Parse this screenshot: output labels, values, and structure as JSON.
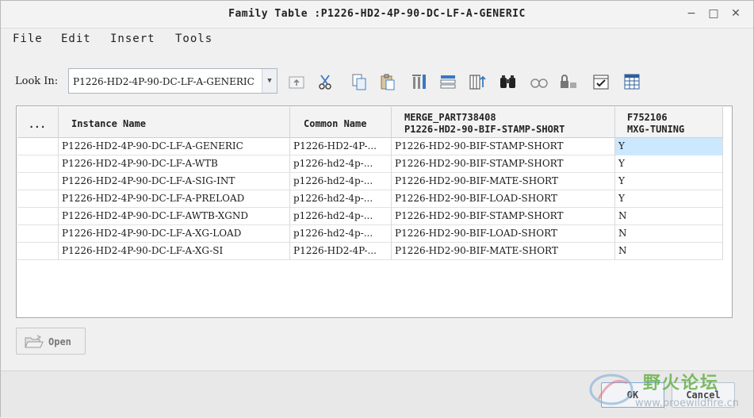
{
  "window": {
    "title": "Family Table :P1226-HD2-4P-90-DC-LF-A-GENERIC",
    "controls": {
      "minimize": "−",
      "maximize": "□",
      "close": "✕"
    }
  },
  "menu": [
    "File",
    "Edit",
    "Insert",
    "Tools"
  ],
  "toolbar": {
    "look_in_label": "Look In:",
    "look_in_value": "P1226-HD2-4P-90-DC-LF-A-GENERIC",
    "icons": [
      "up-level-icon",
      "cut-icon",
      "copy-icon",
      "paste-icon",
      "insert-column-icon",
      "insert-row-icon",
      "table-column-icon",
      "find-icon",
      "preview-icon",
      "lock-icon",
      "verify-icon",
      "table-icon"
    ]
  },
  "table": {
    "headers": {
      "dots": "...",
      "instance": "Instance Name",
      "common": "Common Name",
      "merge_line1": "MERGE_PART738408",
      "merge_line2": "P1226-HD2-90-BIF-STAMP-SHORT",
      "f_line1": "F752106",
      "f_line2": "MXG-TUNING"
    },
    "rows": [
      {
        "instance": "P1226-HD2-4P-90-DC-LF-A-GENERIC",
        "common": "P1226-HD2-4P-...",
        "merge": "P1226-HD2-90-BIF-STAMP-SHORT",
        "f": "Y"
      },
      {
        "instance": "P1226-HD2-4P-90-DC-LF-A-WTB",
        "common": "p1226-hd2-4p-...",
        "merge": "P1226-HD2-90-BIF-STAMP-SHORT",
        "f": "Y"
      },
      {
        "instance": "P1226-HD2-4P-90-DC-LF-A-SIG-INT",
        "common": "p1226-hd2-4p-...",
        "merge": "P1226-HD2-90-BIF-MATE-SHORT",
        "f": "Y"
      },
      {
        "instance": "P1226-HD2-4P-90-DC-LF-A-PRELOAD",
        "common": "p1226-hd2-4p-...",
        "merge": "P1226-HD2-90-BIF-LOAD-SHORT",
        "f": "Y"
      },
      {
        "instance": "P1226-HD2-4P-90-DC-LF-AWTB-XGND",
        "common": "p1226-hd2-4p-...",
        "merge": "P1226-HD2-90-BIF-STAMP-SHORT",
        "f": "N"
      },
      {
        "instance": "P1226-HD2-4P-90-DC-LF-A-XG-LOAD",
        "common": "p1226-hd2-4p-...",
        "merge": "P1226-HD2-90-BIF-LOAD-SHORT",
        "f": "N"
      },
      {
        "instance": "P1226-HD2-4P-90-DC-LF-A-XG-SI",
        "common": "P1226-HD2-4P-...",
        "merge": "P1226-HD2-90-BIF-MATE-SHORT",
        "f": "N"
      }
    ]
  },
  "buttons": {
    "open": "Open",
    "ok": "OK",
    "cancel": "Cancel"
  },
  "watermark": {
    "text": "野火论坛",
    "url": "www.proewildfire.cn"
  },
  "colors": {
    "selection": "#cce8ff",
    "watermark_green": "#5fae3d"
  }
}
